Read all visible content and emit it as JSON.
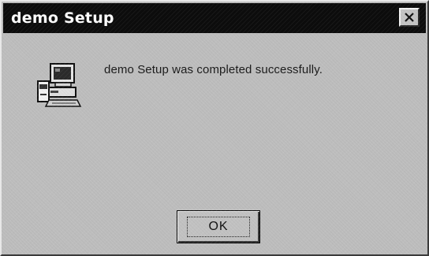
{
  "window": {
    "title": "demo Setup",
    "close_icon": "close-icon"
  },
  "dialog": {
    "icon": "computer-setup-icon",
    "message": "demo Setup was completed successfully.",
    "ok_label": "OK"
  },
  "colors": {
    "titlebar": "#0c0c0c",
    "title_text": "#ffffff",
    "window_bg": "#bebebe"
  }
}
